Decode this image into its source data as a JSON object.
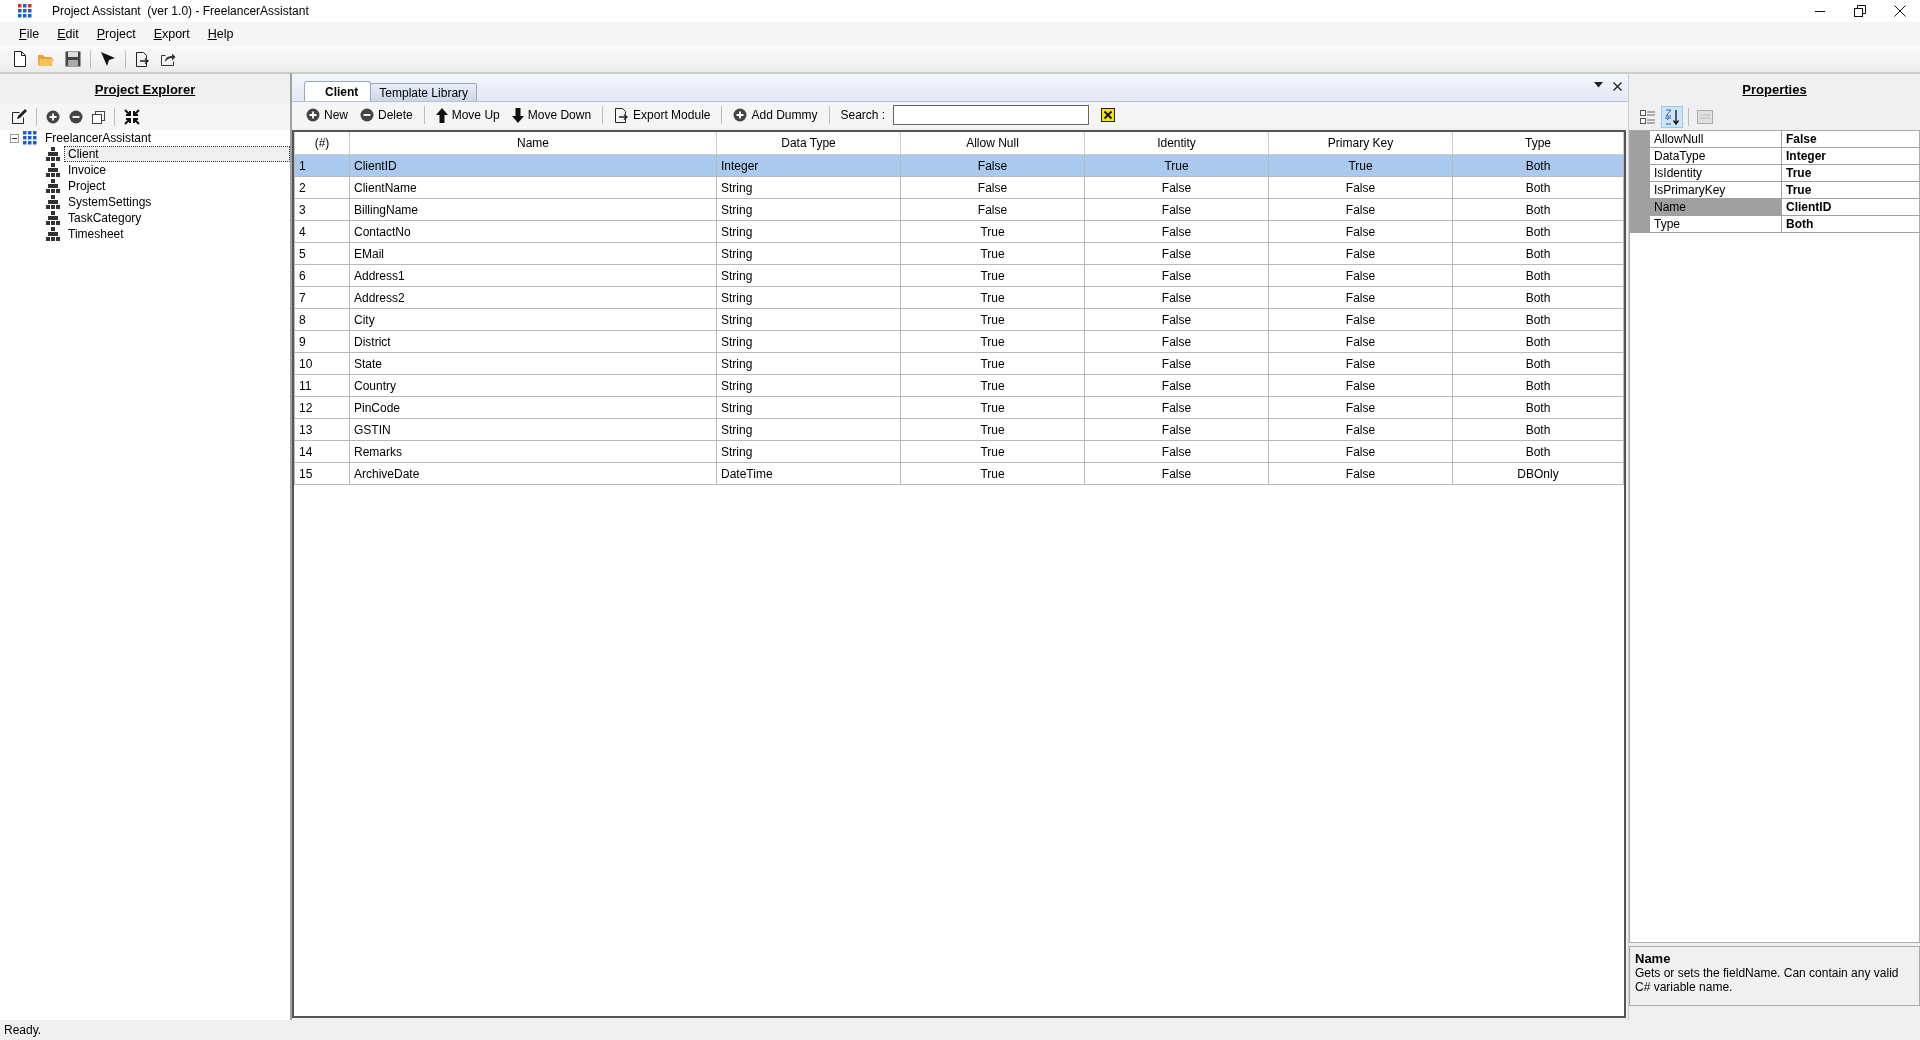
{
  "window": {
    "title": "Project Assistant  (ver 1.0) - FreelancerAssistant"
  },
  "menu": [
    "File",
    "Edit",
    "Project",
    "Export",
    "Help"
  ],
  "explorer": {
    "title": "Project Explorer",
    "tree": {
      "label": "FreelancerAssistant",
      "expanded": true,
      "children": [
        {
          "label": "Client",
          "selected": true
        },
        {
          "label": "Invoice",
          "selected": false
        },
        {
          "label": "Project",
          "selected": false
        },
        {
          "label": "SystemSettings",
          "selected": false
        },
        {
          "label": "TaskCategory",
          "selected": false
        },
        {
          "label": "Timesheet",
          "selected": false
        }
      ]
    }
  },
  "editor": {
    "tabs": [
      {
        "label": "Client",
        "selected": true
      },
      {
        "label": "Template Library",
        "selected": false
      }
    ],
    "actions": [
      {
        "label": "New",
        "kind": "add"
      },
      {
        "label": "Delete",
        "kind": "remove"
      },
      {
        "label": "Move Up",
        "kind": "up"
      },
      {
        "label": "Move Down",
        "kind": "down"
      },
      {
        "label": "Export Module",
        "kind": "export"
      },
      {
        "label": "Add Dummy",
        "kind": "add"
      }
    ],
    "search": {
      "label": "Search :"
    },
    "table": {
      "columns": [
        "(#)",
        "Name",
        "Data Type",
        "Allow Null",
        "Identity",
        "Primary Key",
        "Type"
      ],
      "rows": [
        {
          "cells": [
            "1",
            "ClientID",
            "Integer",
            "False",
            "True",
            "True",
            "Both"
          ],
          "selected": true
        },
        {
          "cells": [
            "2",
            "ClientName",
            "String",
            "False",
            "False",
            "False",
            "Both"
          ],
          "selected": false
        },
        {
          "cells": [
            "3",
            "BillingName",
            "String",
            "False",
            "False",
            "False",
            "Both"
          ],
          "selected": false
        },
        {
          "cells": [
            "4",
            "ContactNo",
            "String",
            "True",
            "False",
            "False",
            "Both"
          ],
          "selected": false
        },
        {
          "cells": [
            "5",
            "EMail",
            "String",
            "True",
            "False",
            "False",
            "Both"
          ],
          "selected": false
        },
        {
          "cells": [
            "6",
            "Address1",
            "String",
            "True",
            "False",
            "False",
            "Both"
          ],
          "selected": false
        },
        {
          "cells": [
            "7",
            "Address2",
            "String",
            "True",
            "False",
            "False",
            "Both"
          ],
          "selected": false
        },
        {
          "cells": [
            "8",
            "City",
            "String",
            "True",
            "False",
            "False",
            "Both"
          ],
          "selected": false
        },
        {
          "cells": [
            "9",
            "District",
            "String",
            "True",
            "False",
            "False",
            "Both"
          ],
          "selected": false
        },
        {
          "cells": [
            "10",
            "State",
            "String",
            "True",
            "False",
            "False",
            "Both"
          ],
          "selected": false
        },
        {
          "cells": [
            "11",
            "Country",
            "String",
            "True",
            "False",
            "False",
            "Both"
          ],
          "selected": false
        },
        {
          "cells": [
            "12",
            "PinCode",
            "String",
            "True",
            "False",
            "False",
            "Both"
          ],
          "selected": false
        },
        {
          "cells": [
            "13",
            "GSTIN",
            "String",
            "True",
            "False",
            "False",
            "Both"
          ],
          "selected": false
        },
        {
          "cells": [
            "14",
            "Remarks",
            "String",
            "True",
            "False",
            "False",
            "Both"
          ],
          "selected": false
        },
        {
          "cells": [
            "15",
            "ArchiveDate",
            "DateTime",
            "True",
            "False",
            "False",
            "DBOnly"
          ],
          "selected": false
        }
      ]
    }
  },
  "properties": {
    "title": "Properties",
    "alphabetical": true,
    "rows": [
      {
        "name": "AllowNull",
        "value": "False",
        "selected": false
      },
      {
        "name": "DataType",
        "value": "Integer",
        "selected": false
      },
      {
        "name": "IsIdentity",
        "value": "True",
        "selected": false
      },
      {
        "name": "IsPrimaryKey",
        "value": "True",
        "selected": false
      },
      {
        "name": "Name",
        "value": "ClientID",
        "selected": true
      },
      {
        "name": "Type",
        "value": "Both",
        "selected": false
      }
    ],
    "help": {
      "title": "Name",
      "text": "Gets or sets the fieldName. Can contain any valid C# variable name."
    }
  },
  "status_bar": "Ready."
}
